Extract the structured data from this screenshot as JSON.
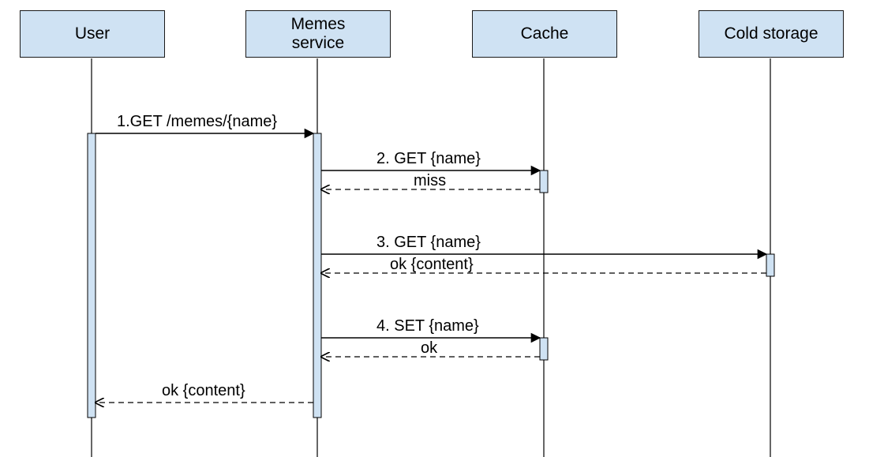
{
  "diagram": {
    "type": "uml-sequence",
    "participants": {
      "user": {
        "label": "User"
      },
      "memes": {
        "label": "Memes\nservice"
      },
      "cache": {
        "label": "Cache"
      },
      "cold": {
        "label": "Cold storage"
      }
    },
    "messages": {
      "m1": "1.GET /memes/{name}",
      "m2": "2. GET {name}",
      "m2r": "miss",
      "m3": "3. GET {name}",
      "m3r": "ok {content}",
      "m4": "4. SET {name}",
      "m4r": "ok",
      "finalr": "ok {content}"
    }
  }
}
